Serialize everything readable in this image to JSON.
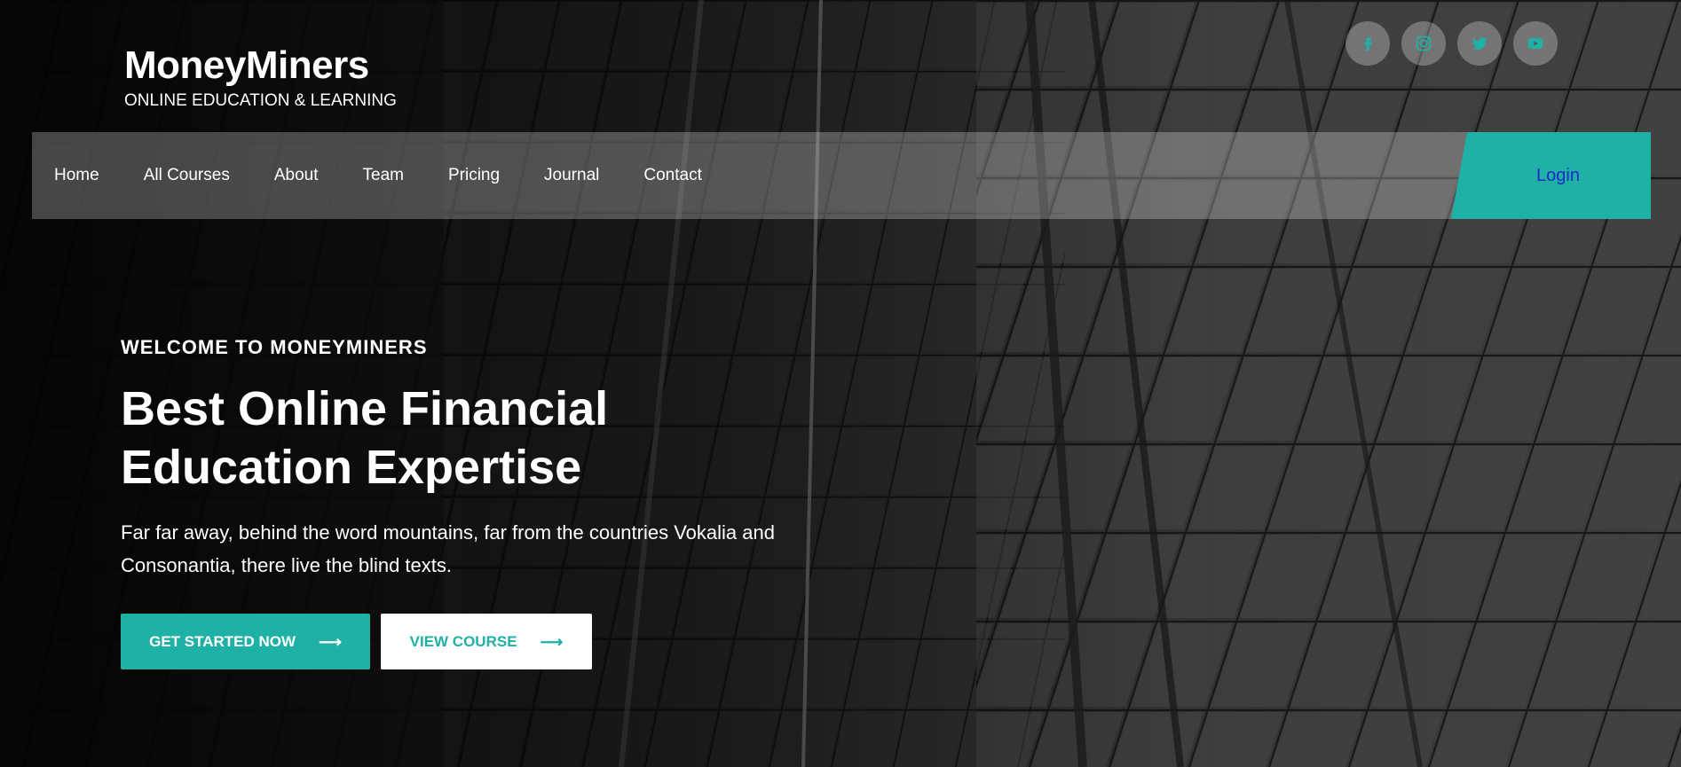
{
  "brand": {
    "name": "MoneyMiners",
    "tagline": "ONLINE EDUCATION & LEARNING"
  },
  "social": [
    {
      "name": "facebook-icon"
    },
    {
      "name": "instagram-icon"
    },
    {
      "name": "twitter-icon"
    },
    {
      "name": "youtube-icon"
    }
  ],
  "nav": {
    "items": [
      {
        "label": "Home"
      },
      {
        "label": "All Courses"
      },
      {
        "label": "About"
      },
      {
        "label": "Team"
      },
      {
        "label": "Pricing"
      },
      {
        "label": "Journal"
      },
      {
        "label": "Contact"
      }
    ],
    "login_label": "Login"
  },
  "hero": {
    "eyebrow": "WELCOME TO MONEYMINERS",
    "headline_line1": "Best Online Financial",
    "headline_line2": "Education Expertise",
    "description_line1": "Far far away, behind the word mountains, far from the countries Vokalia and",
    "description_line2": "Consonantia, there live the blind texts.",
    "primary_button": "GET STARTED NOW",
    "secondary_button": "VIEW COURSE",
    "arrow_glyph": "⟶"
  },
  "colors": {
    "accent": "#1fb1a6",
    "login_text": "#1a2bc8",
    "social_bg": "rgba(255,255,255,0.28)",
    "nav_bg": "rgba(255,255,255,0.26)"
  }
}
